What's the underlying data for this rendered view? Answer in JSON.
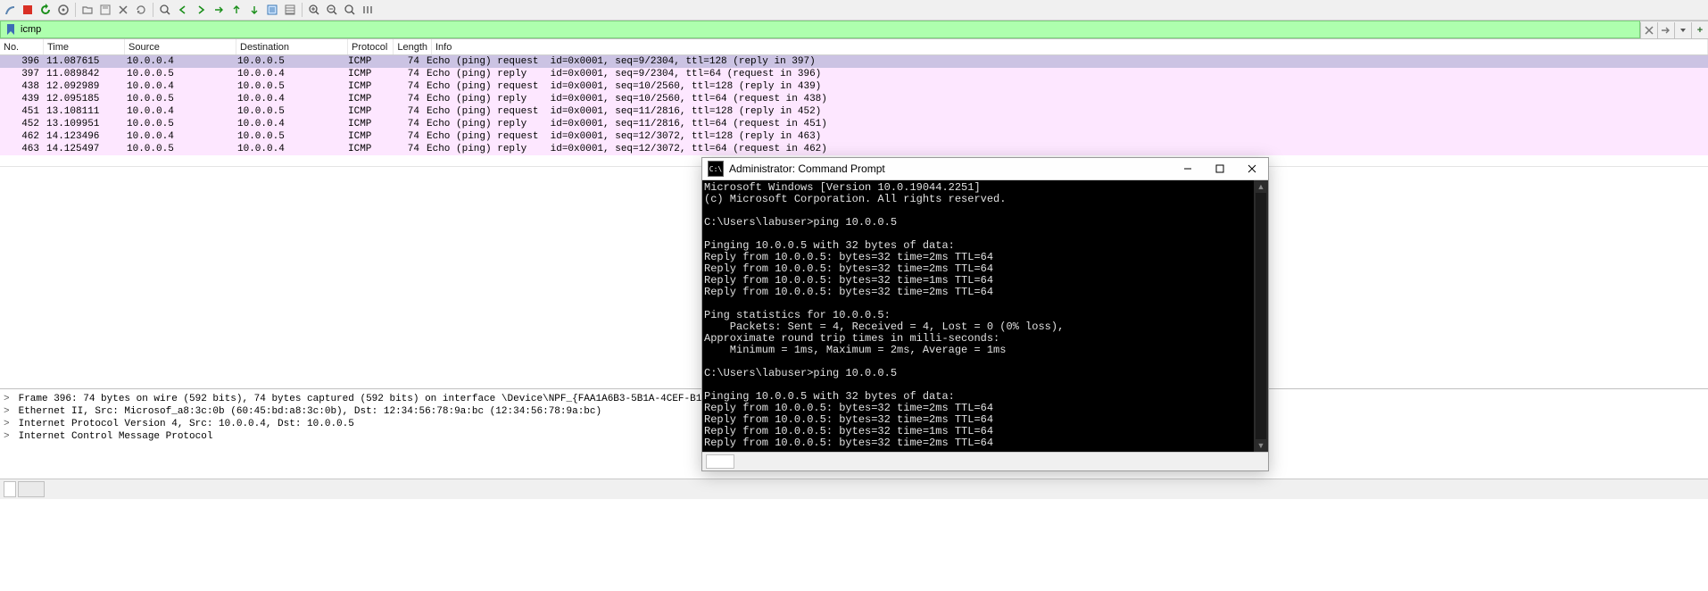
{
  "filter": {
    "value": "icmp"
  },
  "packet_list": {
    "headers": {
      "no": "No.",
      "time": "Time",
      "source": "Source",
      "destination": "Destination",
      "protocol": "Protocol",
      "length": "Length",
      "info": "Info"
    },
    "rows": [
      {
        "no": "396",
        "time": "11.087615",
        "src": "10.0.0.4",
        "dst": "10.0.0.5",
        "proto": "ICMP",
        "len": "74",
        "info": "Echo (ping) request  id=0x0001, seq=9/2304, ttl=128 (reply in 397)",
        "selected": true
      },
      {
        "no": "397",
        "time": "11.089842",
        "src": "10.0.0.5",
        "dst": "10.0.0.4",
        "proto": "ICMP",
        "len": "74",
        "info": "Echo (ping) reply    id=0x0001, seq=9/2304, ttl=64 (request in 396)",
        "selected": false
      },
      {
        "no": "438",
        "time": "12.092989",
        "src": "10.0.0.4",
        "dst": "10.0.0.5",
        "proto": "ICMP",
        "len": "74",
        "info": "Echo (ping) request  id=0x0001, seq=10/2560, ttl=128 (reply in 439)",
        "selected": false
      },
      {
        "no": "439",
        "time": "12.095185",
        "src": "10.0.0.5",
        "dst": "10.0.0.4",
        "proto": "ICMP",
        "len": "74",
        "info": "Echo (ping) reply    id=0x0001, seq=10/2560, ttl=64 (request in 438)",
        "selected": false
      },
      {
        "no": "451",
        "time": "13.108111",
        "src": "10.0.0.4",
        "dst": "10.0.0.5",
        "proto": "ICMP",
        "len": "74",
        "info": "Echo (ping) request  id=0x0001, seq=11/2816, ttl=128 (reply in 452)",
        "selected": false
      },
      {
        "no": "452",
        "time": "13.109951",
        "src": "10.0.0.5",
        "dst": "10.0.0.4",
        "proto": "ICMP",
        "len": "74",
        "info": "Echo (ping) reply    id=0x0001, seq=11/2816, ttl=64 (request in 451)",
        "selected": false
      },
      {
        "no": "462",
        "time": "14.123496",
        "src": "10.0.0.4",
        "dst": "10.0.0.5",
        "proto": "ICMP",
        "len": "74",
        "info": "Echo (ping) request  id=0x0001, seq=12/3072, ttl=128 (reply in 463)",
        "selected": false
      },
      {
        "no": "463",
        "time": "14.125497",
        "src": "10.0.0.5",
        "dst": "10.0.0.4",
        "proto": "ICMP",
        "len": "74",
        "info": "Echo (ping) reply    id=0x0001, seq=12/3072, ttl=64 (request in 462)",
        "selected": false
      }
    ]
  },
  "details": {
    "lines": [
      "Frame 396: 74 bytes on wire (592 bits), 74 bytes captured (592 bits) on interface \\Device\\NPF_{FAA1A6B3-5B1A-4CEF-B1E7-A2AED98B933F},",
      "Ethernet II, Src: Microsof_a8:3c:0b (60:45:bd:a8:3c:0b), Dst: 12:34:56:78:9a:bc (12:34:56:78:9a:bc)",
      "Internet Protocol Version 4, Src: 10.0.0.4, Dst: 10.0.0.5",
      "Internet Control Message Protocol"
    ]
  },
  "cmd": {
    "title": "Administrator: Command Prompt",
    "sysicon_label": "C:\\",
    "text": "Microsoft Windows [Version 10.0.19044.2251]\n(c) Microsoft Corporation. All rights reserved.\n\nC:\\Users\\labuser>ping 10.0.0.5\n\nPinging 10.0.0.5 with 32 bytes of data:\nReply from 10.0.0.5: bytes=32 time=2ms TTL=64\nReply from 10.0.0.5: bytes=32 time=2ms TTL=64\nReply from 10.0.0.5: bytes=32 time=1ms TTL=64\nReply from 10.0.0.5: bytes=32 time=2ms TTL=64\n\nPing statistics for 10.0.0.5:\n    Packets: Sent = 4, Received = 4, Lost = 0 (0% loss),\nApproximate round trip times in milli-seconds:\n    Minimum = 1ms, Maximum = 2ms, Average = 1ms\n\nC:\\Users\\labuser>ping 10.0.0.5\n\nPinging 10.0.0.5 with 32 bytes of data:\nReply from 10.0.0.5: bytes=32 time=2ms TTL=64\nReply from 10.0.0.5: bytes=32 time=2ms TTL=64\nReply from 10.0.0.5: bytes=32 time=1ms TTL=64\nReply from 10.0.0.5: bytes=32 time=2ms TTL=64"
  }
}
